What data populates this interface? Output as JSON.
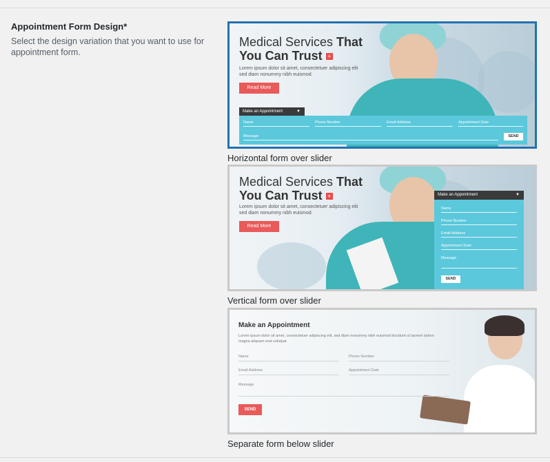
{
  "field": {
    "title": "Appointment Form Design*",
    "description": "Select the design variation that you want to use for appointment form."
  },
  "options": [
    {
      "caption": "Horizontal form over slider",
      "selected": true,
      "hero_title_regular": "Medical Services ",
      "hero_title_bold_1": "That",
      "hero_title_bold_2": "You Can Trust",
      "hero_cross": "+",
      "hero_text": "Lorem ipsum dolor sit amet, consectetuer adipiscing elit sed diam nonummy nibh euismod.",
      "button": "Read More",
      "form_header": "Make an Appointment",
      "fields": [
        "Name",
        "Phone Number",
        "Email Address",
        "Appointment Date",
        "Message"
      ],
      "send": "SEND"
    },
    {
      "caption": "Vertical form over slider",
      "selected": false,
      "hero_title_regular": "Medical Services ",
      "hero_title_bold_1": "That",
      "hero_title_bold_2": "You Can Trust",
      "hero_cross": "+",
      "hero_text": "Lorem ipsum dolor sit amet, consectetuer adipiscing elit sed diam nonummy nibh euismod.",
      "button": "Read More",
      "form_header": "Make an Appointment",
      "fields": [
        "Name",
        "Phone Number",
        "Email Address",
        "Appointment Date",
        "Message"
      ],
      "send": "SEND"
    },
    {
      "caption": "Separate form below slider",
      "selected": false,
      "form_header": "Make an Appointment",
      "form_text": "Lorem ipsum dolor sit amet, consectetuer adipiscing elit, sed diam nonummy nibh euismod tincidunt ut laoreet dolore magna aliquam erat volutpat.",
      "fields": [
        "Name",
        "Phone Number",
        "Email Address",
        "Appointment Date",
        "Message"
      ],
      "send": "SEND"
    }
  ],
  "colors": {
    "accent": "#2271b1",
    "cta": "#e95a5a",
    "form_panel": "#5bc8dc",
    "dark_bar": "#3a3a3a"
  },
  "icons": [
    "caret-down-icon",
    "medical-cross-icon"
  ]
}
